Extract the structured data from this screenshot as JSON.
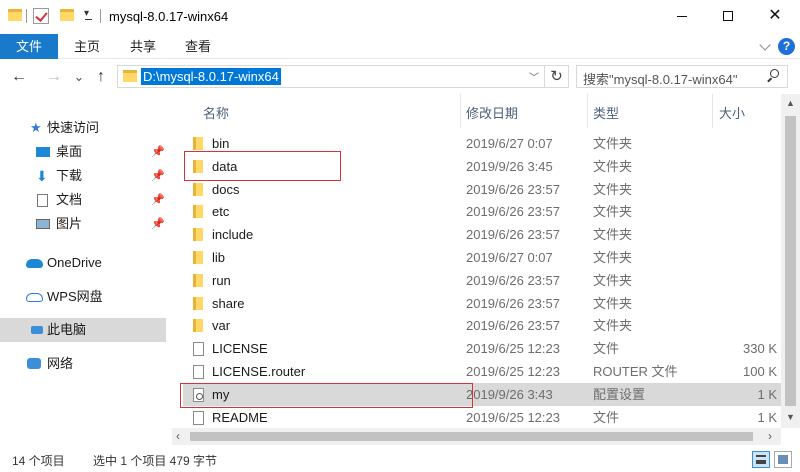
{
  "window": {
    "title": "mysql-8.0.17-winx64",
    "minimize": "—",
    "maximize": "☐",
    "close": "✕"
  },
  "ribbon": {
    "tabs": [
      "文件",
      "主页",
      "共享",
      "查看"
    ],
    "help": "?"
  },
  "addressbar": {
    "back": "←",
    "forward": "→",
    "recent": "⌄",
    "up": "↑",
    "path": "D:\\mysql-8.0.17-winx64",
    "refresh": "↻",
    "search_placeholder": "搜索\"mysql-8.0.17-winx64\""
  },
  "navpane": {
    "quick_access": "快速访问",
    "pinned": [
      {
        "label": "桌面",
        "icon": "desktop-icon"
      },
      {
        "label": "下载",
        "icon": "download-icon"
      },
      {
        "label": "文档",
        "icon": "document-icon"
      },
      {
        "label": "图片",
        "icon": "pictures-icon"
      }
    ],
    "onedrive": "OneDrive",
    "wps": "WPS网盘",
    "this_pc": "此电脑",
    "network": "网络"
  },
  "columns": {
    "name": "名称",
    "date": "修改日期",
    "type": "类型",
    "size": "大小"
  },
  "files": [
    {
      "name": "bin",
      "date": "2019/6/27 0:07",
      "type": "文件夹",
      "size": "",
      "kind": "folder"
    },
    {
      "name": "data",
      "date": "2019/9/26 3:45",
      "type": "文件夹",
      "size": "",
      "kind": "folder"
    },
    {
      "name": "docs",
      "date": "2019/6/26 23:57",
      "type": "文件夹",
      "size": "",
      "kind": "folder"
    },
    {
      "name": "etc",
      "date": "2019/6/26 23:57",
      "type": "文件夹",
      "size": "",
      "kind": "folder"
    },
    {
      "name": "include",
      "date": "2019/6/26 23:57",
      "type": "文件夹",
      "size": "",
      "kind": "folder"
    },
    {
      "name": "lib",
      "date": "2019/6/27 0:07",
      "type": "文件夹",
      "size": "",
      "kind": "folder"
    },
    {
      "name": "run",
      "date": "2019/6/26 23:57",
      "type": "文件夹",
      "size": "",
      "kind": "folder"
    },
    {
      "name": "share",
      "date": "2019/6/26 23:57",
      "type": "文件夹",
      "size": "",
      "kind": "folder"
    },
    {
      "name": "var",
      "date": "2019/6/26 23:57",
      "type": "文件夹",
      "size": "",
      "kind": "folder"
    },
    {
      "name": "LICENSE",
      "date": "2019/6/25 12:23",
      "type": "文件",
      "size": "330 K",
      "kind": "file"
    },
    {
      "name": "LICENSE.router",
      "date": "2019/6/25 12:23",
      "type": "ROUTER 文件",
      "size": "100 K",
      "kind": "file"
    },
    {
      "name": "my",
      "date": "2019/9/26 3:43",
      "type": "配置设置",
      "size": "1 K",
      "kind": "config"
    },
    {
      "name": "README",
      "date": "2019/6/25 12:23",
      "type": "文件",
      "size": "1 K",
      "kind": "file"
    }
  ],
  "status": {
    "count": "14 个项目",
    "selected": "选中 1 个项目  479 字节"
  },
  "colors": {
    "accent": "#1979ca",
    "selection": "#d9d9d9",
    "highlight_box": "#d9303a",
    "folder": "#ffd866"
  }
}
